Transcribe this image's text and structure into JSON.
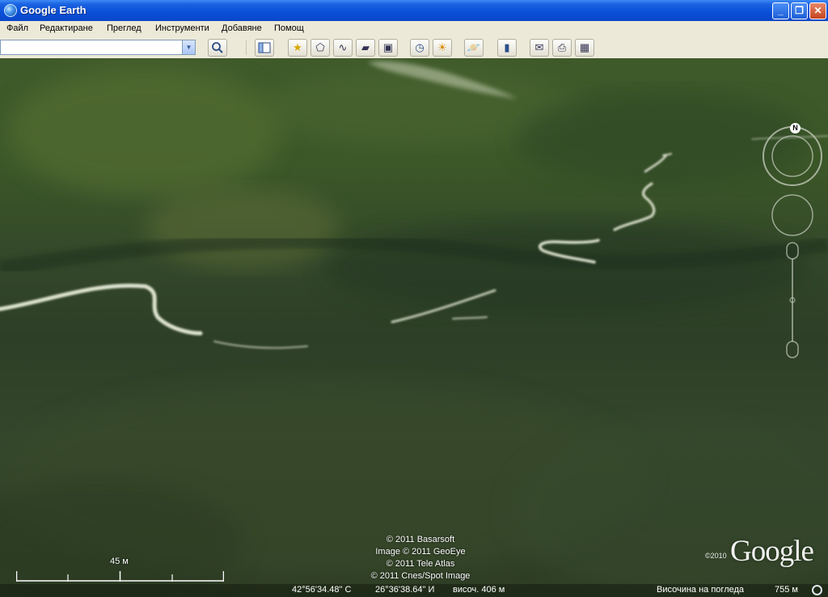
{
  "window": {
    "title": "Google Earth"
  },
  "menu": [
    "Файл",
    "Редактиране",
    "Преглед",
    "Инструменти",
    "Добавяне",
    "Помощ"
  ],
  "search": {
    "value": "",
    "placeholder": ""
  },
  "toolbar": {
    "icons": [
      "search-icon",
      "sidebar-toggle-icon",
      "placemark-icon",
      "polygon-icon",
      "path-icon",
      "image-overlay-icon",
      "record-tour-icon",
      "historical-imagery-icon",
      "sunlight-icon",
      "planets-icon",
      "ruler-icon",
      "email-icon",
      "print-icon",
      "save-image-icon"
    ]
  },
  "attribution": [
    "© 2011 Basarsoft",
    "Image © 2011 GeoEye",
    "© 2011 Tele Atlas",
    "© 2011 Cnes/Spot Image"
  ],
  "logo": {
    "text": "Google",
    "year": "©2010"
  },
  "scale": {
    "label": "45 м"
  },
  "nav": {
    "north_label": "N"
  },
  "status": {
    "lat": "42°56'34.48\" С",
    "lon": "26°36'38.64\" И",
    "elev": "височ.  406 м",
    "eye_label": "Височина на погледа",
    "eye_value": "755 м"
  },
  "colors": {
    "titlebar": "#0a4fd8",
    "chrome": "#ece9d8",
    "terrain": "#33472a"
  }
}
